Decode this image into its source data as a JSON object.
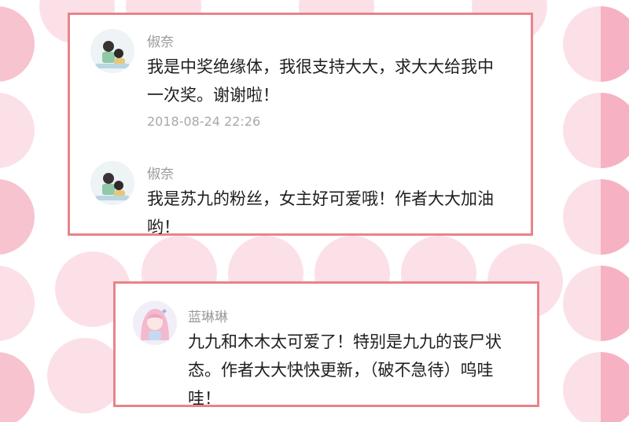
{
  "comments": [
    {
      "username": "俶奈",
      "avatar": "child-photo-avatar",
      "text": "我是中奖绝缘体，我很支持大大，求大大给我中一次奖。谢谢啦！",
      "timestamp": "2018-08-24 22:26"
    },
    {
      "username": "俶奈",
      "avatar": "child-photo-avatar",
      "text": "我是苏九的粉丝，女主好可爱哦！作者大大加油哟！"
    },
    {
      "username": "蓝琳琳",
      "avatar": "anime-girl-avatar",
      "text": "九九和木木太可爱了！特别是九九的丧尸状态。作者大大快快更新，（破不急待）呜哇哇！"
    }
  ],
  "colors": {
    "card_border": "#e8838b",
    "dot_light": "#fbe1e7",
    "dot_accent": "#f6b2c2",
    "username": "#9a9a9a",
    "text": "#1e1e1e",
    "timestamp": "#a8a8a8"
  }
}
